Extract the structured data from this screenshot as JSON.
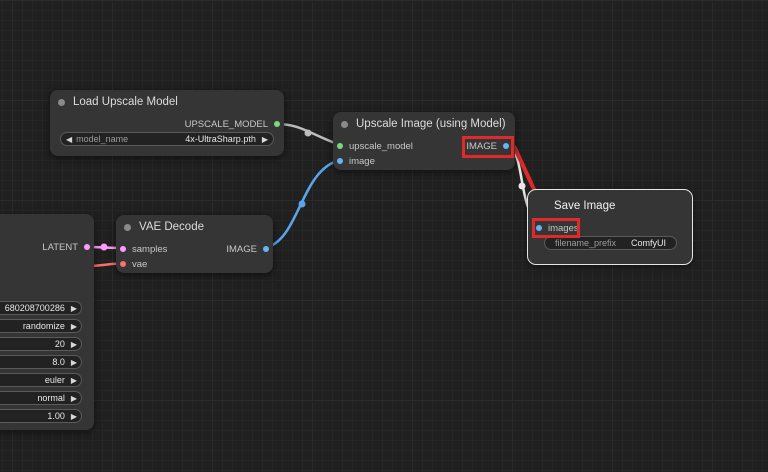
{
  "colors": {
    "accent_red": "#e02a2a",
    "slot_upscale_model": "#7ed67e",
    "slot_image": "#64b5f6",
    "slot_latent": "#ff9cf9",
    "slot_vae": "#ff6e6e",
    "wire_image": "#5aa5e8",
    "wire_model": "#bdbdbd"
  },
  "sampler_node": {
    "output_latent": "LATENT",
    "widgets": [
      "680208700286",
      "randomize",
      "20",
      "8.0",
      "euler",
      "normal",
      "1.00"
    ]
  },
  "load_upscale_model": {
    "title": "Load Upscale Model",
    "output": "UPSCALE_MODEL",
    "widget_label": "model_name",
    "widget_value": "4x-UltraSharp.pth"
  },
  "upscale_image": {
    "title": "Upscale Image (using Model)",
    "input_model": "upscale_model",
    "input_image": "image",
    "output": "IMAGE"
  },
  "vae_decode": {
    "title": "VAE Decode",
    "input_samples": "samples",
    "input_vae": "vae",
    "output": "IMAGE"
  },
  "save_image": {
    "title": "Save Image",
    "input_images": "images",
    "widget_label": "filename_prefix",
    "widget_value": "ComfyUI"
  },
  "icons": {
    "left_arrow": "◀",
    "right_arrow": "▶"
  }
}
